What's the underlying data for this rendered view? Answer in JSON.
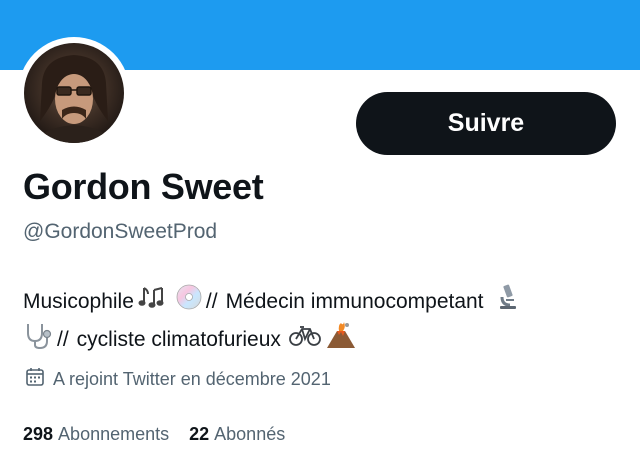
{
  "profile": {
    "name": "Gordon Sweet",
    "handle": "@GordonSweetProd",
    "follow_label": "Suivre",
    "bio": {
      "line1_a": "Musicophile",
      "line1_b": "//",
      "line1_c": "Médecin immunocompetant",
      "line2_a": "//",
      "line2_b": "cycliste climatofurieux"
    },
    "bio_emoji": [
      "music-notes-icon",
      "cd-disc-icon",
      "microscope-icon",
      "stethoscope-icon",
      "bicycle-icon",
      "volcano-icon"
    ],
    "joined": "A rejoint Twitter en décembre 2021",
    "stats": [
      {
        "count": "298",
        "label": "Abonnements"
      },
      {
        "count": "22",
        "label": "Abonnés"
      }
    ]
  },
  "colors": {
    "banner": "#1d9bf0",
    "button_bg": "#0f1419",
    "secondary_text": "#536471"
  }
}
